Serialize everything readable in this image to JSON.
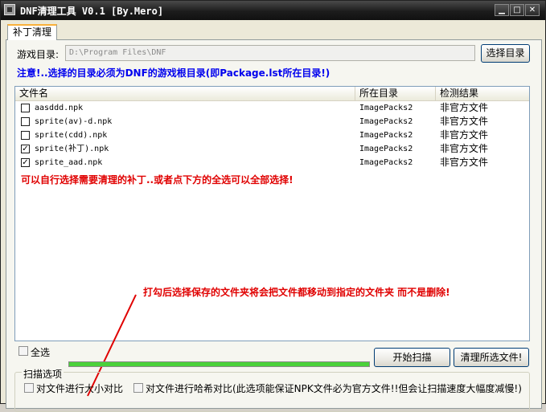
{
  "window": {
    "title": "DNF清理工具 V0.1 [By.Mero]",
    "minimize_glyph": "▁",
    "maximize_glyph": "□",
    "close_glyph": "✕"
  },
  "tabs": [
    {
      "label": "补丁清理",
      "active": true
    }
  ],
  "directory": {
    "label": "游戏目录:",
    "value": "D:\\Program Files\\DNF",
    "browse_button": "选择目录"
  },
  "notice": "注意!..选择的目录必须为DNF的游戏根目录(即Package.lst所在目录!)",
  "file_list": {
    "columns": [
      "文件名",
      "所在目录",
      "检测结果"
    ],
    "rows": [
      {
        "name": "aasddd.npk",
        "folder": "ImagePacks2",
        "result": "非官方文件",
        "checked": false
      },
      {
        "name": "sprite(av)-d.npk",
        "folder": "ImagePacks2",
        "result": "非官方文件",
        "checked": false
      },
      {
        "name": "sprite(cdd).npk",
        "folder": "ImagePacks2",
        "result": "非官方文件",
        "checked": false
      },
      {
        "name": "sprite(补丁).npk",
        "folder": "ImagePacks2",
        "result": "非官方文件",
        "checked": true
      },
      {
        "name": "sprite_aad.npk",
        "folder": "ImagePacks2",
        "result": "非官方文件",
        "checked": true
      }
    ],
    "hint": "可以自行选择需要清理的补丁..或者点下方的全选可以全部选择!",
    "annotation": "打勾后选择保存的文件夹将会把文件都移动到指定的文件夹 而不是删除!"
  },
  "select_all": {
    "label": "全选",
    "checked": false
  },
  "progress": {
    "fraction": 1.0
  },
  "buttons": {
    "scan": "开始扫描",
    "clean": "清理所选文件!"
  },
  "scan_options": {
    "title": "扫描选项",
    "option1": "对文件进行大小对比",
    "option2": "对文件进行哈希对比(此选项能保证NPK文件必为官方文件!!但会让扫描速度大幅度减慢!)"
  },
  "colors": {
    "notice": "#0000ee",
    "hint": "#e00000",
    "progress": "#4bd13a",
    "titlebar": "#1c1c1c"
  }
}
